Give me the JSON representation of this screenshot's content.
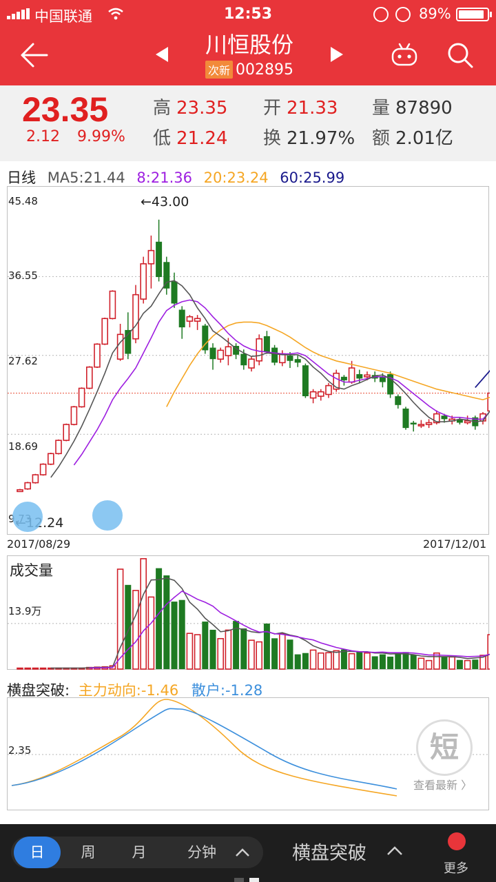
{
  "status": {
    "carrier": "中国联通",
    "time": "12:53",
    "battery": "89%",
    "battery_level": 0.89
  },
  "header": {
    "name": "川恒股份",
    "tag": "次新",
    "code": "002895"
  },
  "quote": {
    "price": "23.35",
    "change": "2.12",
    "change_pct": "9.99%",
    "high_label": "高",
    "high": "23.35",
    "low_label": "低",
    "low": "21.24",
    "open_label": "开",
    "open": "21.33",
    "turnover_label": "换",
    "turnover": "21.97%",
    "volume_label": "量",
    "volume": "87890",
    "amount_label": "额",
    "amount": "2.01亿"
  },
  "ma_line": {
    "period": "日线",
    "ma5": "MA5:21.44",
    "ma8": "8:21.36",
    "ma20": "20:23.24",
    "ma60": "60:25.99"
  },
  "kline": {
    "y_ticks": [
      "45.48",
      "36.55",
      "27.62",
      "18.69",
      "9.73"
    ],
    "max_note": "←43.00",
    "min_note": "←12.24",
    "start_date": "2017/08/29",
    "end_date": "2017/12/01"
  },
  "volume": {
    "title": "成交量",
    "tick": "13.9万"
  },
  "indicator": {
    "name": "横盘突破:",
    "main": "主力动向:-1.46",
    "retail": "散户:-1.28",
    "tick": "2.35",
    "badge": "短",
    "more": "查看最新 〉"
  },
  "colors": {
    "up": "#d0202a",
    "down": "#1e7a22",
    "ma5": "#555555",
    "ma8": "#9d1ee0",
    "ma20": "#f5a623",
    "ma60": "#1a1a8c",
    "header": "#e8353a"
  },
  "bottom": {
    "tabs": [
      "日",
      "周",
      "月",
      "分钟"
    ],
    "active_tab": "日",
    "indicator": "横盘突破",
    "more": "更多"
  },
  "chart_data": {
    "type": "candlestick",
    "x_start": "2017/08/29",
    "x_end": "2017/12/01",
    "ylim": [
      9.73,
      45.48
    ],
    "candles": [
      [
        12.2,
        12.4,
        12.24,
        12.5
      ],
      [
        12.5,
        13.2,
        12.4,
        13.3
      ],
      [
        13.2,
        14.1,
        13.1,
        14.2
      ],
      [
        14.1,
        15.3,
        14.0,
        15.4
      ],
      [
        15.3,
        16.5,
        15.2,
        16.6
      ],
      [
        16.5,
        18.0,
        16.4,
        18.1
      ],
      [
        18.0,
        19.8,
        17.9,
        19.9
      ],
      [
        19.8,
        21.8,
        19.7,
        21.9
      ],
      [
        21.8,
        23.9,
        21.7,
        24.0
      ],
      [
        23.9,
        26.3,
        23.8,
        26.4
      ],
      [
        26.3,
        28.9,
        26.2,
        29.0
      ],
      [
        28.9,
        31.8,
        28.8,
        31.9
      ],
      [
        31.8,
        34.9,
        31.7,
        35.0
      ],
      [
        27.2,
        30.0,
        27.0,
        31.2
      ],
      [
        30.5,
        27.8,
        27.2,
        32.5
      ],
      [
        29.5,
        34.5,
        29.0,
        35.6
      ],
      [
        34.0,
        38.0,
        33.5,
        38.8
      ],
      [
        38.0,
        39.5,
        35.2,
        41.2
      ],
      [
        40.5,
        36.5,
        36.0,
        43.0
      ],
      [
        38.2,
        35.2,
        34.5,
        38.8
      ],
      [
        36.0,
        33.5,
        33.0,
        37.0
      ],
      [
        32.8,
        30.8,
        29.5,
        33.2
      ],
      [
        31.5,
        32.0,
        30.8,
        32.2
      ],
      [
        31.5,
        31.8,
        30.5,
        32.2
      ],
      [
        31.0,
        28.2,
        27.8,
        31.2
      ],
      [
        28.5,
        27.2,
        26.0,
        29.0
      ],
      [
        27.2,
        28.2,
        26.8,
        28.5
      ],
      [
        27.6,
        28.6,
        26.5,
        29.6
      ],
      [
        28.7,
        27.7,
        27.2,
        29.0
      ],
      [
        27.8,
        26.5,
        26.0,
        28.3
      ],
      [
        26.2,
        27.2,
        25.8,
        27.5
      ],
      [
        27.0,
        29.5,
        26.5,
        30.0
      ],
      [
        29.8,
        28.0,
        27.8,
        30.4
      ],
      [
        28.5,
        26.8,
        26.5,
        28.8
      ],
      [
        26.8,
        27.8,
        26.4,
        28.2
      ],
      [
        27.6,
        27.0,
        26.2,
        28.0
      ],
      [
        27.2,
        26.8,
        26.3,
        27.6
      ],
      [
        26.5,
        23.0,
        22.8,
        26.7
      ],
      [
        22.8,
        23.5,
        22.2,
        23.8
      ],
      [
        23.0,
        23.5,
        22.5,
        23.8
      ],
      [
        23.2,
        24.2,
        22.8,
        24.5
      ],
      [
        23.8,
        25.6,
        23.5,
        26.0
      ],
      [
        25.2,
        24.8,
        24.2,
        25.4
      ],
      [
        24.6,
        26.2,
        24.4,
        27.0
      ],
      [
        25.5,
        25.0,
        24.5,
        26.0
      ],
      [
        25.2,
        25.4,
        24.8,
        25.8
      ],
      [
        25.4,
        25.0,
        24.6,
        25.8
      ],
      [
        25.2,
        24.6,
        24.0,
        25.6
      ],
      [
        25.5,
        23.2,
        22.8,
        25.8
      ],
      [
        23.0,
        22.0,
        21.6,
        23.2
      ],
      [
        21.6,
        19.4,
        19.2,
        21.8
      ],
      [
        20.0,
        19.8,
        19.0,
        20.2
      ],
      [
        19.8,
        19.8,
        19.4,
        20.3
      ],
      [
        19.8,
        20.0,
        19.4,
        20.4
      ],
      [
        20.0,
        21.0,
        19.8,
        21.4
      ],
      [
        20.8,
        20.4,
        20.0,
        21.0
      ],
      [
        20.2,
        20.4,
        19.8,
        20.8
      ],
      [
        20.4,
        20.0,
        19.8,
        20.6
      ],
      [
        20.0,
        20.2,
        19.8,
        20.8
      ],
      [
        20.6,
        19.6,
        19.2,
        20.8
      ],
      [
        20.2,
        21.0,
        19.8,
        21.2
      ],
      [
        21.33,
        23.35,
        21.24,
        23.35
      ]
    ],
    "ma5": [
      null,
      null,
      null,
      null,
      13.8,
      15.0,
      16.4,
      17.9,
      19.6,
      21.5,
      23.5,
      25.6,
      27.9,
      29.1,
      30.0,
      31.0,
      32.4,
      33.2,
      34.6,
      35.9,
      36.1,
      35.5,
      34.5,
      33.0,
      31.8,
      30.4,
      29.8,
      29.1,
      28.4,
      27.9,
      27.5,
      27.6,
      27.9,
      27.8,
      27.7,
      27.7,
      27.7,
      27.2,
      26.3,
      25.6,
      24.7,
      24.0,
      23.8,
      24.2,
      24.5,
      24.9,
      25.3,
      25.4,
      25.0,
      24.2,
      23.3,
      22.3,
      21.4,
      20.6,
      20.1,
      20.1,
      20.2,
      20.4,
      20.3,
      20.1,
      20.2,
      21.44
    ],
    "ma8": [
      null,
      null,
      null,
      null,
      null,
      null,
      null,
      15.2,
      16.4,
      17.8,
      19.2,
      20.8,
      22.6,
      23.9,
      25.0,
      26.2,
      27.9,
      29.6,
      31.4,
      32.7,
      33.3,
      33.7,
      33.9,
      33.7,
      33.0,
      32.0,
      31.1,
      30.1,
      29.3,
      28.7,
      28.3,
      28.1,
      28.0,
      27.9,
      27.8,
      27.8,
      27.9,
      27.6,
      26.9,
      26.2,
      25.5,
      25.0,
      24.6,
      24.6,
      24.8,
      25.0,
      25.2,
      25.2,
      25.1,
      24.7,
      24.0,
      23.3,
      22.6,
      21.9,
      21.3,
      20.9,
      20.6,
      20.6,
      20.5,
      20.4,
      20.4,
      21.36
    ],
    "ma20": [
      null,
      null,
      null,
      null,
      null,
      null,
      null,
      null,
      null,
      null,
      null,
      null,
      null,
      null,
      null,
      null,
      null,
      null,
      null,
      21.8,
      23.5,
      25.0,
      26.5,
      27.8,
      28.9,
      29.8,
      30.5,
      31.0,
      31.3,
      31.4,
      31.4,
      31.3,
      31.0,
      30.6,
      30.2,
      29.7,
      29.1,
      28.5,
      28.0,
      27.6,
      27.3,
      27.0,
      26.8,
      26.6,
      26.4,
      26.2,
      26.0,
      25.8,
      25.6,
      25.3,
      25.0,
      24.7,
      24.4,
      24.1,
      23.8,
      23.6,
      23.4,
      23.2,
      23.0,
      22.8,
      22.6,
      22.9
    ],
    "ma60_segment": [
      23.98,
      25.99
    ],
    "volume_wan": [
      0.3,
      0.3,
      0.3,
      0.3,
      0.3,
      0.3,
      0.3,
      0.3,
      0.3,
      0.5,
      0.6,
      0.7,
      1.0,
      30.5,
      25.7,
      24.0,
      33.7,
      22.0,
      30.8,
      28.6,
      20.6,
      21.1,
      10.9,
      10.5,
      14.5,
      12.0,
      9.3,
      11.9,
      14.7,
      12.4,
      8.8,
      8.3,
      13.9,
      9.4,
      10.8,
      9.0,
      4.5,
      4.9,
      5.8,
      4.9,
      5.0,
      5.6,
      6.0,
      4.7,
      5.4,
      4.9,
      3.9,
      4.5,
      3.8,
      5.1,
      5.2,
      4.4,
      3.3,
      2.6,
      4.9,
      3.8,
      3.7,
      2.8,
      2.6,
      2.9,
      4.2,
      10.5
    ],
    "vol_ma_short": [
      null,
      null,
      null,
      null,
      0.3,
      0.3,
      0.3,
      0.3,
      0.3,
      0.4,
      0.5,
      0.5,
      0.6,
      6.6,
      11.6,
      16.4,
      22.8,
      27.2,
      27.3,
      27.8,
      27.1,
      24.6,
      20.4,
      18.3,
      15.5,
      13.6,
      11.4,
      11.7,
      12.5,
      12.1,
      11.4,
      11.1,
      11.6,
      10.7,
      11.1,
      10.4,
      9.9,
      8.7,
      7.1,
      6.2,
      5.4,
      5.1,
      5.4,
      5.4,
      5.3,
      5.3,
      4.9,
      4.9,
      4.6,
      4.7,
      4.6,
      4.4,
      4.0,
      3.8,
      3.8,
      3.8,
      3.8,
      3.6,
      3.2,
      3.4,
      3.6,
      4.6
    ],
    "vol_ma_long": [
      null,
      null,
      null,
      null,
      null,
      null,
      null,
      null,
      null,
      0.34,
      0.37,
      0.41,
      0.48,
      3.4,
      6.0,
      8.3,
      11.7,
      14.0,
      17.0,
      19.8,
      21.9,
      23.8,
      22.6,
      21.3,
      20.4,
      19.2,
      17.2,
      16.0,
      14.7,
      13.4,
      12.2,
      11.3,
      11.4,
      10.8,
      10.6,
      10.2,
      9.8,
      9.3,
      8.9,
      8.0,
      7.3,
      6.6,
      6.1,
      5.6,
      5.3,
      5.2,
      5.1,
      5.2,
      5.0,
      5.0,
      5.0,
      4.9,
      4.6,
      4.3,
      4.3,
      4.2,
      4.1,
      4.0,
      3.8,
      3.9,
      4.0,
      4.6
    ]
  }
}
